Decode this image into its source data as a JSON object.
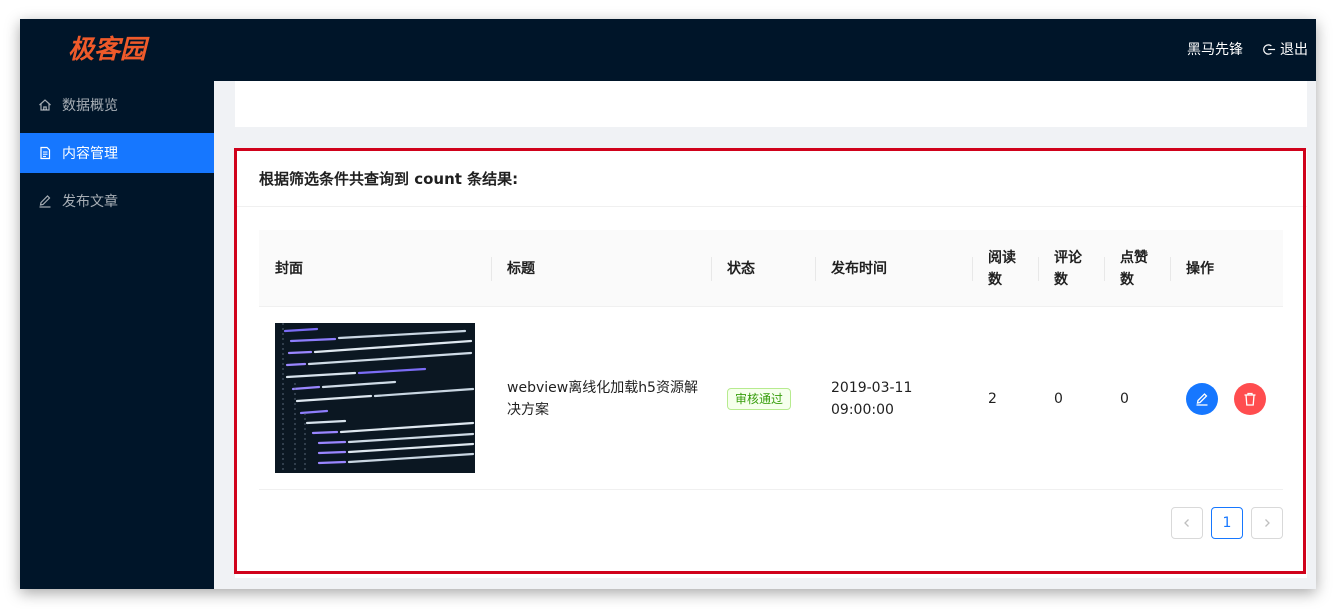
{
  "app": {
    "logo_text": "极客园",
    "username": "黑马先锋",
    "logout_label": "退出"
  },
  "sidebar": {
    "items": [
      {
        "label": "数据概览",
        "icon": "home-icon",
        "active": false
      },
      {
        "label": "内容管理",
        "icon": "document-icon",
        "active": true
      },
      {
        "label": "发布文章",
        "icon": "edit-icon",
        "active": false
      }
    ]
  },
  "results": {
    "header": "根据筛选条件共查询到 count 条结果:"
  },
  "table": {
    "columns": [
      "封面",
      "标题",
      "状态",
      "发布时间",
      "阅读数",
      "评论数",
      "点赞数",
      "操作"
    ],
    "rows": [
      {
        "cover": "code-screenshot-image",
        "title": "webview离线化加载h5资源解决方案",
        "status": "审核通过",
        "publish_time": "2019-03-11 09:00:00",
        "read_count": "2",
        "comment_count": "0",
        "like_count": "0"
      }
    ]
  },
  "pagination": {
    "current_page": "1"
  },
  "colors": {
    "sidebar_bg": "#001529",
    "accent": "#1677ff",
    "danger": "#ff4d4f",
    "logo": "#ef5a2a",
    "success": "#389e0d",
    "highlight": "#d0021b"
  }
}
